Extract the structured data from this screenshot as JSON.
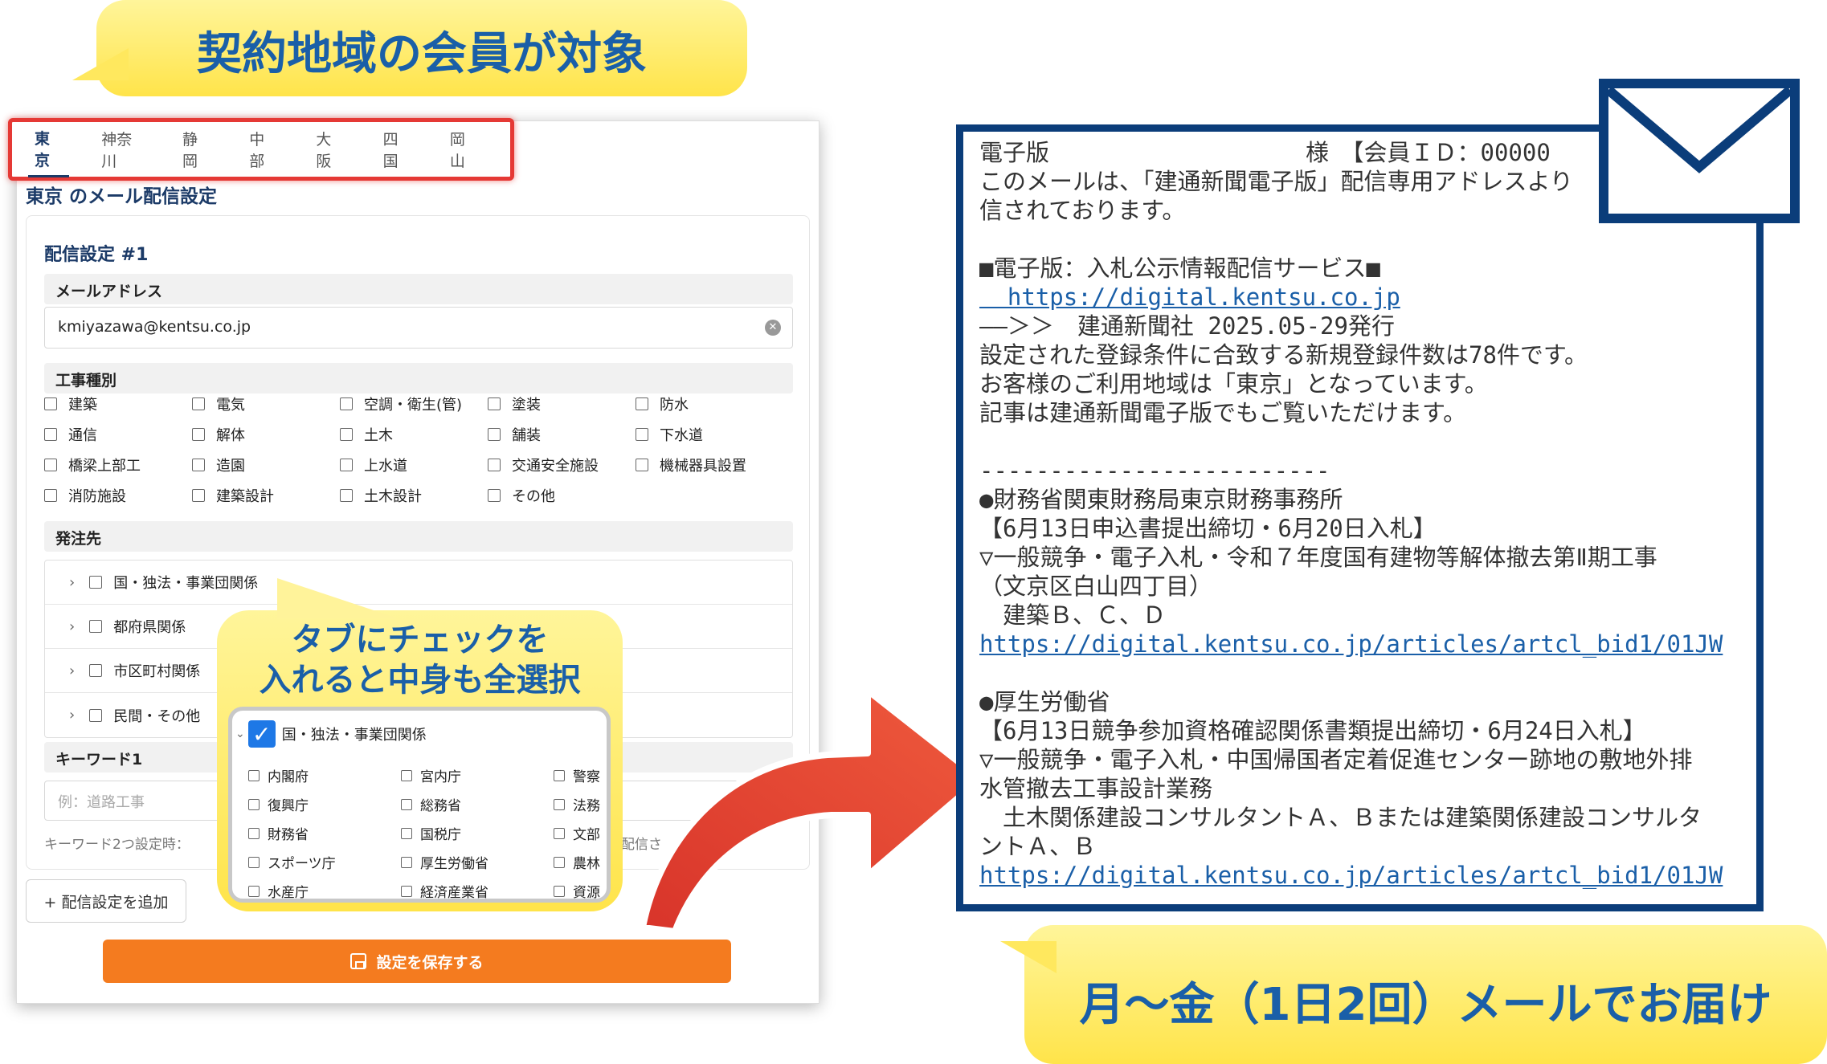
{
  "headline_top": "契約地域の会員が対象",
  "headline_bottom": "月〜金（1日2回）メールでお届け",
  "tabs": [
    "東京",
    "神奈川",
    "静岡",
    "中部",
    "大阪",
    "四国",
    "岡山"
  ],
  "section_title": "東京 のメール配信設定",
  "card": {
    "title": "配信設定 #1",
    "email_label": "メールアドレス",
    "email_value": "kmiyazawa@kentsu.co.jp",
    "work_type_label": "工事種別",
    "work_types": [
      "建築",
      "電気",
      "空調・衛生(管)",
      "塗装",
      "防水",
      "通信",
      "解体",
      "土木",
      "舗装",
      "下水道",
      "橋梁上部工",
      "造園",
      "上水道",
      "交通安全施設",
      "機械器具設置",
      "消防施設",
      "建築設計",
      "土木設計",
      "その他"
    ],
    "orderer_label": "発注先",
    "orderers": [
      "国・独法・事業団関係",
      "都府県関係",
      "市区町村関係",
      "民間・その他"
    ],
    "keyword_label": "キーワード1",
    "keyword_placeholder": "例：道路工事",
    "keyword_note": "キーワード2つ設定時：",
    "keyword_note_tail": "が配信さ"
  },
  "add_button": "+ 配信設定を追加",
  "save_button": "設定を保存する",
  "callout": {
    "text_line1": "タブにチェックを",
    "text_line2": "入れると中身も全選択",
    "group": "国・独法・事業団関係",
    "items": [
      "内閣府",
      "宮内庁",
      "警察",
      "復興庁",
      "総務省",
      "法務",
      "財務省",
      "国税庁",
      "文部",
      "スポーツ庁",
      "厚生労働省",
      "農林",
      "水産庁",
      "経済産業省",
      "資源"
    ]
  },
  "mail": {
    "lines": [
      {
        "t": "電子版　　　　　　　　　　　様　【会員ＩＤ：00000",
        "link": false
      },
      {
        "t": "このメールは、「建通新聞電子版」配信専用アドレスより",
        "link": false
      },
      {
        "t": "信されております。",
        "link": false
      },
      {
        "t": "",
        "link": false
      },
      {
        "t": "■電子版：入札公示情報配信サービス■",
        "link": false
      },
      {
        "t": "  https://digital.kentsu.co.jp",
        "link": true
      },
      {
        "t": "——＞＞　建通新聞社 2025.05-29発行",
        "link": false
      },
      {
        "t": "設定された登録条件に合致する新規登録件数は78件です。",
        "link": false
      },
      {
        "t": "お客様のご利用地域は「東京」となっています。",
        "link": false
      },
      {
        "t": "記事は建通新聞電子版でもご覧いただけます。",
        "link": false
      },
      {
        "t": "",
        "link": false
      },
      {
        "t": "-------------------------",
        "link": false
      },
      {
        "t": "●財務省関東財務局東京財務事務所",
        "link": false
      },
      {
        "t": "【6月13日申込書提出締切・6月20日入札】",
        "link": false
      },
      {
        "t": "▽一般競争・電子入札・令和７年度国有建物等解体撤去第Ⅱ期工事",
        "link": false
      },
      {
        "t": "（文京区白山四丁目）",
        "link": false
      },
      {
        "t": "　建築Ｂ、Ｃ、Ｄ",
        "link": false
      },
      {
        "t": "https://digital.kentsu.co.jp/articles/artcl_bid1/01JW",
        "link": true
      },
      {
        "t": "",
        "link": false
      },
      {
        "t": "●厚生労働省",
        "link": false
      },
      {
        "t": "【6月13日競争参加資格確認関係書類提出締切・6月24日入札】",
        "link": false
      },
      {
        "t": "▽一般競争・電子入札・中国帰国者定着促進センター跡地の敷地外排",
        "link": false
      },
      {
        "t": "水管撤去工事設計業務",
        "link": false
      },
      {
        "t": "　土木関係建設コンサルタントＡ、Ｂまたは建築関係建設コンサルタ",
        "link": false
      },
      {
        "t": "ントＡ、Ｂ",
        "link": false
      },
      {
        "t": "https://digital.kentsu.co.jp/articles/artcl_bid1/01JW",
        "link": true
      }
    ]
  },
  "colors": {
    "accent_blue": "#1a5fa8",
    "navy": "#0b3d7a",
    "orange": "#f47b1f",
    "red": "#e53935",
    "yellow": "#ffe44a"
  }
}
